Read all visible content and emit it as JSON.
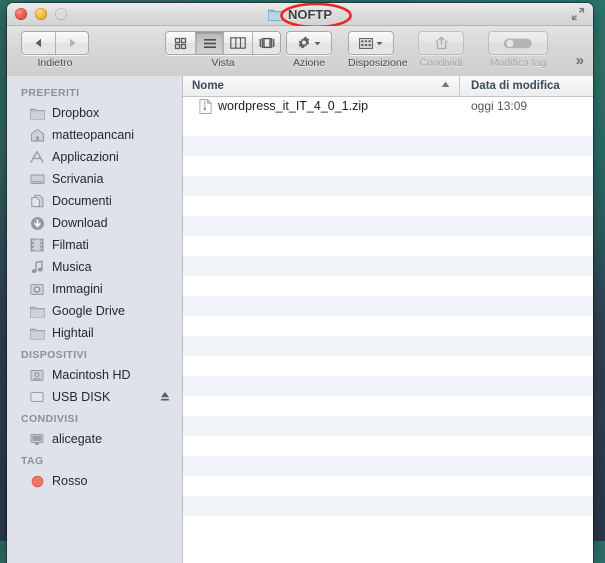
{
  "window": {
    "title": "NOFTP",
    "title_icon": "folder-icon",
    "fullscreen_icon": "fullscreen-expand-icon",
    "lights": [
      {
        "name": "close-button",
        "color": "#ee5f55"
      },
      {
        "name": "minimize-button",
        "color": "#f5bb42"
      },
      {
        "name": "zoom-button",
        "color": "#8ed14f"
      }
    ],
    "annotation_color": "#e8281c"
  },
  "toolbar": {
    "back_forward": {
      "label": "Indietro",
      "back_icon": "triangle-left-icon",
      "forward_icon": "triangle-right-icon"
    },
    "view": {
      "label": "Vista",
      "segments": [
        {
          "name": "view-icon-grid",
          "icon": "grid-icon",
          "selected": false
        },
        {
          "name": "view-list",
          "icon": "list-icon",
          "selected": true
        },
        {
          "name": "view-columns",
          "icon": "columns-icon",
          "selected": false
        },
        {
          "name": "view-coverflow",
          "icon": "coverflow-icon",
          "selected": false
        }
      ]
    },
    "action": {
      "label": "Azione",
      "icon": "gear-icon",
      "chevron": "chevron-down-icon"
    },
    "arrange": {
      "label": "Disposizione",
      "icon": "grid-small-icon",
      "chevron": "chevron-down-icon"
    },
    "share": {
      "label": "Condividi",
      "icon": "share-icon",
      "disabled": true
    },
    "edit_tags": {
      "label": "Modifica tag",
      "icon": "tag-toggle-icon",
      "disabled": true
    },
    "overflow": "»"
  },
  "sidebar": {
    "sections": [
      {
        "header": "PREFERITI",
        "items": [
          {
            "label": "Dropbox",
            "icon": "folder-icon"
          },
          {
            "label": "matteopancani",
            "icon": "home-icon"
          },
          {
            "label": "Applicazioni",
            "icon": "applications-icon"
          },
          {
            "label": "Scrivania",
            "icon": "desktop-icon"
          },
          {
            "label": "Documenti",
            "icon": "documents-icon"
          },
          {
            "label": "Download",
            "icon": "download-icon"
          },
          {
            "label": "Filmati",
            "icon": "film-icon"
          },
          {
            "label": "Musica",
            "icon": "music-note-icon"
          },
          {
            "label": "Immagini",
            "icon": "photos-icon"
          },
          {
            "label": "Google Drive",
            "icon": "folder-icon"
          },
          {
            "label": "Hightail",
            "icon": "folder-icon"
          }
        ]
      },
      {
        "header": "DISPOSITIVI",
        "items": [
          {
            "label": "Macintosh HD",
            "icon": "hard-disk-icon"
          },
          {
            "label": "USB DISK",
            "icon": "external-disk-icon",
            "eject": "eject-icon"
          }
        ]
      },
      {
        "header": "CONDIVISI",
        "items": [
          {
            "label": "alicegate",
            "icon": "server-icon"
          }
        ]
      },
      {
        "header": "TAG",
        "items": [
          {
            "label": "Rosso",
            "icon": "red-dot-icon",
            "dot_color": "#f0756b"
          }
        ]
      }
    ]
  },
  "file_list": {
    "columns": [
      {
        "label": "Nome",
        "sorted": true,
        "sort_icon": "sort-ascending-icon"
      },
      {
        "label": "Data di modifica",
        "sorted": false
      }
    ],
    "files": [
      {
        "name": "wordpress_it_IT_4_0_1.zip",
        "modified": "oggi 13:09",
        "icon": "zip-file-icon"
      }
    ],
    "empty_row_count": 21
  }
}
